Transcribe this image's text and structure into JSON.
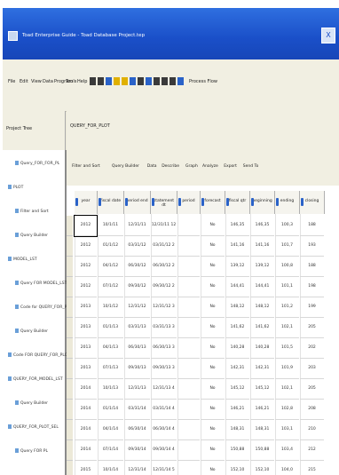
{
  "window": {
    "title": "Toad Enterprise Guide - Toad Database Project.tep",
    "close_label": "X"
  },
  "menu": [
    "File",
    "Edit",
    "View",
    "Data",
    "Program",
    "Tools",
    "Help"
  ],
  "toolbar": {
    "icon_colors": [
      "#3a3a3a",
      "#3a3a3a",
      "#2a62c8",
      "#e0b000",
      "#e0b000",
      "#2a62c8",
      "#3a3a3a",
      "#2a62c8",
      "#3a3a3a",
      "#3a3a3a",
      "#3a3a3a",
      "#2a62c8"
    ],
    "process_flow_label": "Process Flow"
  },
  "project_panel": {
    "title": "Project Tree",
    "items": [
      {
        "label": "Query_FOR_FOR_PL",
        "depth": 1
      },
      {
        "label": "PLOT",
        "depth": 0
      },
      {
        "label": "Filter and Sort",
        "depth": 1
      },
      {
        "label": "Query Builder",
        "depth": 1
      },
      {
        "label": "MODEL_LST",
        "depth": 0
      },
      {
        "label": "Query FOR MODEL_LST",
        "depth": 1
      },
      {
        "label": "Code for QUERY_FOR_PL",
        "depth": 1
      },
      {
        "label": "Query Builder",
        "depth": 1
      },
      {
        "label": "Code FOR QUERY_FOR_PLOT",
        "depth": 0
      },
      {
        "label": "QUERY_FOR_MODEL_LST",
        "depth": 0
      },
      {
        "label": "Query Builder",
        "depth": 1
      },
      {
        "label": "QUERY_FOR_PLOT_SEL",
        "depth": 0
      },
      {
        "label": "Query FOR PL",
        "depth": 1
      }
    ]
  },
  "content": {
    "tab_label": "QUERY_FOR_PLOT",
    "query_toolbar": [
      "Filter and Sort",
      "Query Builder",
      "Data",
      "Describe",
      "Graph",
      "Analyze",
      "Export",
      "Send To"
    ]
  },
  "table": {
    "columns": [
      "year",
      "fiscal date",
      "period end",
      "statement dt",
      "period",
      "forecast",
      "fiscal qtr",
      "beginning",
      "ending",
      "closing"
    ],
    "rows": [
      [
        "2012",
        "10/1/11",
        "12/31/11",
        "12/31/11 12",
        "",
        "No",
        "146,35",
        "146,35",
        "100,3",
        "188"
      ],
      [
        "2012",
        "01/1/12",
        "03/31/12",
        "03/31/12 2",
        "",
        "No",
        "141,16",
        "141,16",
        "101,7",
        "193"
      ],
      [
        "2012",
        "04/1/12",
        "06/30/12",
        "06/30/12 2",
        "",
        "No",
        "139,12",
        "139,12",
        "100,8",
        "188"
      ],
      [
        "2012",
        "07/1/12",
        "09/30/12",
        "09/30/12 2",
        "",
        "No",
        "144,41",
        "144,41",
        "101,1",
        "198"
      ],
      [
        "2013",
        "10/1/12",
        "12/31/12",
        "12/31/12 3",
        "",
        "No",
        "148,12",
        "148,12",
        "101,2",
        "199"
      ],
      [
        "2013",
        "01/1/13",
        "03/31/13",
        "03/31/13 3",
        "",
        "No",
        "141,62",
        "141,62",
        "102,1",
        "205"
      ],
      [
        "2013",
        "04/1/13",
        "06/30/13",
        "06/30/13 3",
        "",
        "No",
        "140,28",
        "140,28",
        "101,5",
        "202"
      ],
      [
        "2013",
        "07/1/13",
        "09/30/13",
        "09/30/13 3",
        "",
        "No",
        "142,31",
        "142,31",
        "101,9",
        "203"
      ],
      [
        "2014",
        "10/1/13",
        "12/31/13",
        "12/31/13 4",
        "",
        "No",
        "145,12",
        "145,12",
        "102,1",
        "205"
      ],
      [
        "2014",
        "01/1/14",
        "03/31/14",
        "03/31/14 4",
        "",
        "No",
        "146,21",
        "146,21",
        "102,8",
        "208"
      ],
      [
        "2014",
        "04/1/14",
        "06/30/14",
        "06/30/14 4",
        "",
        "No",
        "148,31",
        "148,31",
        "103,1",
        "210"
      ],
      [
        "2014",
        "07/1/14",
        "09/30/14",
        "09/30/14 4",
        "",
        "No",
        "150,88",
        "150,88",
        "103,4",
        "212"
      ],
      [
        "2015",
        "10/1/14",
        "12/31/14",
        "12/31/14 5",
        "",
        "No",
        "152,10",
        "152,10",
        "104,0",
        "215"
      ]
    ]
  }
}
